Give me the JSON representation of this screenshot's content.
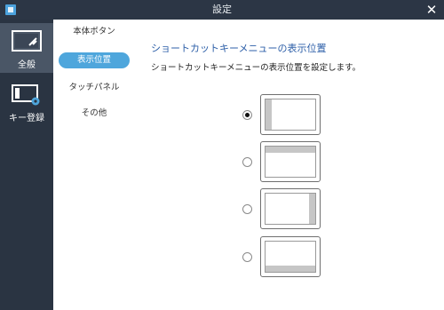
{
  "window": {
    "title": "設定",
    "close_label": "✕"
  },
  "nav": {
    "items": [
      {
        "label": "全般",
        "icon": "display-icon"
      },
      {
        "label": "キー登録",
        "icon": "key-settings-icon"
      }
    ]
  },
  "subnav": {
    "items": [
      {
        "label": "本体ボタン"
      },
      {
        "label": "表示位置"
      },
      {
        "label": "タッチパネル"
      },
      {
        "label": "その他"
      }
    ],
    "active": "表示位置"
  },
  "content": {
    "heading": "ショートカットキーメニューの表示位置",
    "description": "ショートカットキーメニューの表示位置を設定します。",
    "options": [
      {
        "position": "left",
        "selected": true
      },
      {
        "position": "top",
        "selected": false
      },
      {
        "position": "right",
        "selected": false
      },
      {
        "position": "bottom",
        "selected": false
      }
    ]
  },
  "colors": {
    "titlebar": "#2c3645",
    "sidebar": "#2a3442",
    "sidebar_active": "#4a5666",
    "accent": "#4ea6dc",
    "heading": "#2d5fa8"
  }
}
